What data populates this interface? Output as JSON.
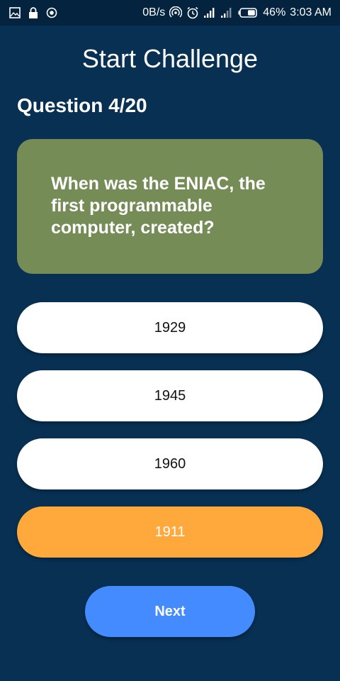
{
  "status_bar": {
    "left_icons": [
      "image-icon",
      "lock-icon",
      "record-icon"
    ],
    "network_speed": "0B/s",
    "right_icons": [
      "hotspot-icon",
      "alarm-icon",
      "signal-icon",
      "signal-2-icon",
      "battery-icon"
    ],
    "battery": "46%",
    "time": "3:03 AM"
  },
  "header": {
    "title": "Start Challenge"
  },
  "quiz": {
    "counter": "Question 4/20",
    "question": "When was the ENIAC, the first programmable computer, created?",
    "answers": [
      "1929",
      "1945",
      "1960",
      "1911"
    ],
    "selected_index": 3,
    "next_label": "Next"
  },
  "colors": {
    "background": "#073052",
    "status_bar": "#03233f",
    "question_card": "#768c57",
    "answer_default": "#ffffff",
    "answer_selected": "#ffa93c",
    "next_button": "#448bff"
  }
}
